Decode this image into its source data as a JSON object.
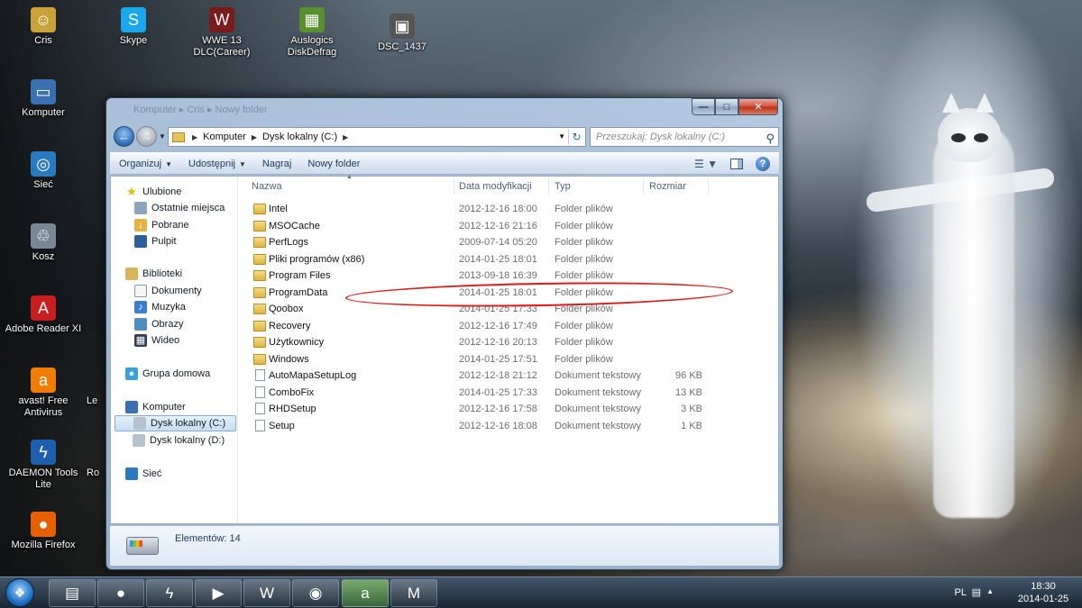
{
  "desktop": {
    "icons": [
      {
        "label": "Cris",
        "icon": "user-folder-icon",
        "glyph": "☺",
        "color": "#c9a23a"
      },
      {
        "label": "Skype",
        "icon": "skype-icon",
        "glyph": "S",
        "color": "#1aa7ec"
      },
      {
        "label": "WWE 13 DLC(Career)",
        "icon": "game-icon",
        "glyph": "W",
        "color": "#7a1c1c"
      },
      {
        "label": "Auslogics DiskDefrag",
        "icon": "defrag-icon",
        "glyph": "▦",
        "color": "#5a8f2e"
      },
      {
        "label": "DSC_1437",
        "icon": "photo-icon",
        "glyph": "▣",
        "color": "#555"
      },
      {
        "label": "Komputer",
        "icon": "computer-icon",
        "glyph": "▭",
        "color": "#3a6fb0"
      },
      {
        "label": "Sieć",
        "icon": "network-icon",
        "glyph": "◎",
        "color": "#2a7ac0"
      },
      {
        "label": "Kosz",
        "icon": "recycle-bin-icon",
        "glyph": "♲",
        "color": "#7a8896"
      },
      {
        "label": "Adobe Reader XI",
        "icon": "adobe-reader-icon",
        "glyph": "A",
        "color": "#c81e1e"
      },
      {
        "label": "avast! Free Antivirus",
        "icon": "avast-icon",
        "glyph": "a",
        "color": "#f07d00"
      },
      {
        "label": "Le",
        "icon": "partial-icon",
        "glyph": "",
        "color": "transparent"
      },
      {
        "label": "DAEMON Tools Lite",
        "icon": "daemon-tools-icon",
        "glyph": "ϟ",
        "color": "#1f5fb0"
      },
      {
        "label": "Ro",
        "icon": "partial-icon-2",
        "glyph": "",
        "color": "transparent"
      },
      {
        "label": "Mozilla Firefox",
        "icon": "firefox-icon",
        "glyph": "●",
        "color": "#e66000"
      }
    ]
  },
  "window": {
    "title_buttons": {
      "min": "—",
      "max": "□",
      "close": "✕"
    },
    "ghost_title": "Komputer ▸ Cris ▸ Nowy folder",
    "address": {
      "crumbs": [
        "Komputer",
        "Dysk lokalny (C:)"
      ],
      "search_placeholder": "Przeszukaj: Dysk lokalny (C:)"
    },
    "commands": {
      "organize": "Organizuj",
      "share": "Udostępnij",
      "burn": "Nagraj",
      "new_folder": "Nowy folder"
    },
    "nav_pane": {
      "favorites": "Ulubione",
      "recent": "Ostatnie miejsca",
      "downloads": "Pobrane",
      "desktop": "Pulpit",
      "libraries": "Biblioteki",
      "documents": "Dokumenty",
      "music": "Muzyka",
      "pictures": "Obrazy",
      "videos": "Wideo",
      "homegroup": "Grupa domowa",
      "computer": "Komputer",
      "drive_c": "Dysk lokalny (C:)",
      "drive_d": "Dysk lokalny (D:)",
      "network": "Sieć"
    },
    "columns": {
      "name": "Nazwa",
      "date": "Data modyfikacji",
      "type": "Typ",
      "size": "Rozmiar"
    },
    "files": [
      {
        "name": "Intel",
        "date": "2012-12-16 18:00",
        "type": "Folder plików",
        "size": "",
        "kind": "folder"
      },
      {
        "name": "MSOCache",
        "date": "2012-12-16 21:16",
        "type": "Folder plików",
        "size": "",
        "kind": "folder"
      },
      {
        "name": "PerfLogs",
        "date": "2009-07-14 05:20",
        "type": "Folder plików",
        "size": "",
        "kind": "folder"
      },
      {
        "name": "Pliki programów (x86)",
        "date": "2014-01-25 18:01",
        "type": "Folder plików",
        "size": "",
        "kind": "folder"
      },
      {
        "name": "Program Files",
        "date": "2013-09-18 16:39",
        "type": "Folder plików",
        "size": "",
        "kind": "folder"
      },
      {
        "name": "ProgramData",
        "date": "2014-01-25 18:01",
        "type": "Folder plików",
        "size": "",
        "kind": "folder"
      },
      {
        "name": "Qoobox",
        "date": "2014-01-25 17:33",
        "type": "Folder plików",
        "size": "",
        "kind": "folder"
      },
      {
        "name": "Recovery",
        "date": "2012-12-16 17:49",
        "type": "Folder plików",
        "size": "",
        "kind": "folder"
      },
      {
        "name": "Użytkownicy",
        "date": "2012-12-16 20:13",
        "type": "Folder plików",
        "size": "",
        "kind": "folder"
      },
      {
        "name": "Windows",
        "date": "2014-01-25 17:51",
        "type": "Folder plików",
        "size": "",
        "kind": "folder"
      },
      {
        "name": "AutoMapaSetupLog",
        "date": "2012-12-18 21:12",
        "type": "Dokument tekstowy",
        "size": "96 KB",
        "kind": "doc"
      },
      {
        "name": "ComboFix",
        "date": "2014-01-25 17:33",
        "type": "Dokument tekstowy",
        "size": "13 KB",
        "kind": "doc"
      },
      {
        "name": "RHDSetup",
        "date": "2012-12-16 17:58",
        "type": "Dokument tekstowy",
        "size": "3 KB",
        "kind": "doc"
      },
      {
        "name": "Setup",
        "date": "2012-12-16 18:08",
        "type": "Dokument tekstowy",
        "size": "1 KB",
        "kind": "doc"
      }
    ],
    "highlighted_file": "ProgramData",
    "details": {
      "count": "Elementów: 14"
    }
  },
  "taskbar": {
    "buttons": [
      {
        "icon": "explorer-icon",
        "glyph": "▤"
      },
      {
        "icon": "firefox-taskbar-icon",
        "glyph": "●"
      },
      {
        "icon": "winamp-icon",
        "glyph": "ϟ"
      },
      {
        "icon": "media-player-icon",
        "glyph": "▶"
      },
      {
        "icon": "word-icon",
        "glyph": "W"
      },
      {
        "icon": "chrome-icon",
        "glyph": "◉"
      },
      {
        "icon": "avast-taskbar-icon",
        "glyph": "a"
      },
      {
        "icon": "malwarebytes-icon",
        "glyph": "M"
      }
    ],
    "tray": {
      "language": "PL",
      "time": "18:30",
      "date": "2014-01-25"
    }
  }
}
